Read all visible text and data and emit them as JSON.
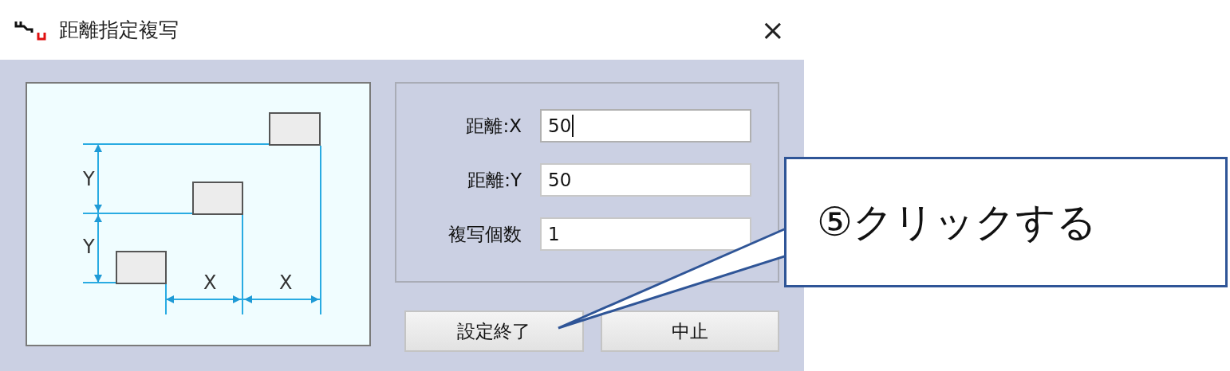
{
  "window": {
    "title": "距離指定複写",
    "close": "×"
  },
  "diagram": {
    "labels": [
      "Y",
      "Y",
      "X",
      "X"
    ]
  },
  "fields": [
    {
      "label": "距離:X",
      "value": "50",
      "focused": true
    },
    {
      "label": "距離:Y",
      "value": "50",
      "focused": false
    },
    {
      "label": "複写個数",
      "value": "1",
      "focused": false
    }
  ],
  "buttons": [
    {
      "label": "設定終了"
    },
    {
      "label": "中止"
    }
  ],
  "callout": {
    "text": "⑤クリックする"
  }
}
